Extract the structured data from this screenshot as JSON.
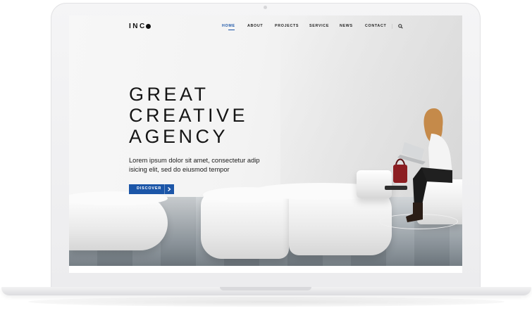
{
  "site": {
    "logo_text": "INC"
  },
  "nav": {
    "items": [
      {
        "label": "HOME",
        "active": true
      },
      {
        "label": "ABOUT",
        "active": false
      },
      {
        "label": "PROJECTS",
        "active": false
      },
      {
        "label": "SERVICE",
        "active": false
      },
      {
        "label": "NEWS",
        "active": false
      },
      {
        "label": "CONTACT",
        "active": false
      }
    ],
    "search_icon": "search-icon"
  },
  "hero": {
    "title": "GREAT\nCREATIVE\nAGENCY",
    "subtitle": "Lorem ipsum dolor sit amet, consectetur adip isicing elit, sed do eiusmod tempor",
    "button_label": "DISCOVER",
    "button_icon": "chevron-right-icon"
  },
  "colors": {
    "accent": "#1c56a8",
    "text": "#151515",
    "background": "#ffffff"
  }
}
